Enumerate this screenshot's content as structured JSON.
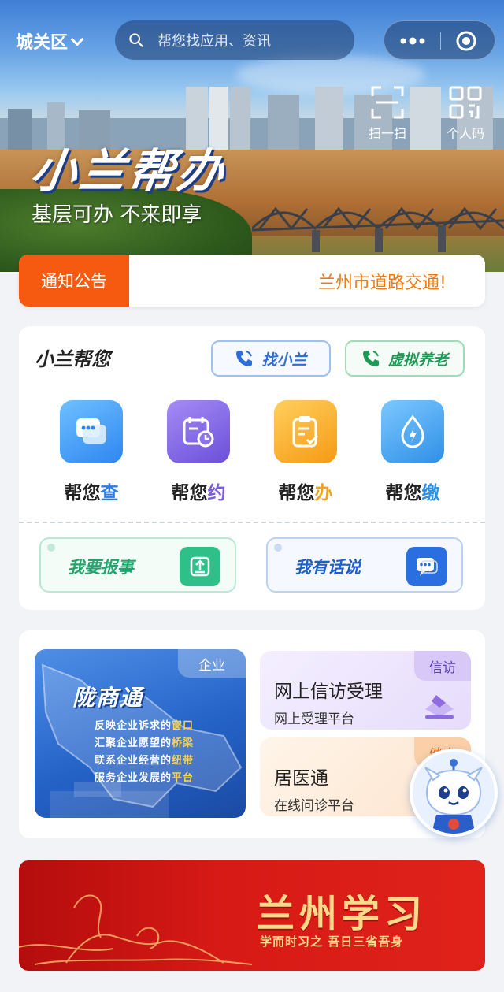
{
  "header": {
    "location": "城关区",
    "search_placeholder": "帮您找应用、资讯",
    "scan_label": "扫一扫",
    "qrcode_label": "个人码"
  },
  "hero": {
    "title": "小兰帮办",
    "slogan": "基层可办 不来即享"
  },
  "notice": {
    "tag": "通知公告",
    "text": "兰州市道路交通!"
  },
  "help_section": {
    "title": "小兰帮您",
    "buttons": [
      {
        "label": "找小兰",
        "color": "#2f6ed8"
      },
      {
        "label": "虚拟养老",
        "color": "#1f9a55"
      }
    ],
    "services": [
      {
        "label_a": "帮您",
        "label_b": "查",
        "accent": "#2f7be6",
        "icon": "chat-bubble-icon"
      },
      {
        "label_a": "帮您",
        "label_b": "约",
        "accent": "#7a5ce0",
        "icon": "calendar-clock-icon"
      },
      {
        "label_a": "帮您",
        "label_b": "办",
        "accent": "#f0a21f",
        "icon": "clipboard-check-icon"
      },
      {
        "label_a": "帮您",
        "label_b": "缴",
        "accent": "#2f8fe6",
        "icon": "water-drop-bolt-icon"
      }
    ],
    "actions": [
      {
        "label": "我要报事",
        "icon": "upload-tray-icon"
      },
      {
        "label": "我有话说",
        "icon": "chat-dots-icon"
      }
    ]
  },
  "features": {
    "longshangtong": {
      "tag": "企业",
      "name": "陇商通",
      "lines": [
        {
          "a": "反映企业诉求的",
          "b": "窗口"
        },
        {
          "a": "汇聚企业愿望的",
          "b": "桥梁"
        },
        {
          "a": "联系企业经营的",
          "b": "纽带"
        },
        {
          "a": "服务企业发展的",
          "b": "平台"
        }
      ]
    },
    "xinfang": {
      "tag": "信访",
      "title": "网上信访受理",
      "subtitle": "网上受理平台"
    },
    "juyitong": {
      "tag": "健康",
      "title": "居医通",
      "subtitle": "在线问诊平台"
    }
  },
  "banner": {
    "title": "兰州学习",
    "subtitle": "学而时习之 吾日三省吾身"
  },
  "colors": {
    "notice_orange": "#f55a10",
    "primary_blue": "#2f6ed8",
    "green": "#1f9a55",
    "banner_red": "#d81a16"
  }
}
